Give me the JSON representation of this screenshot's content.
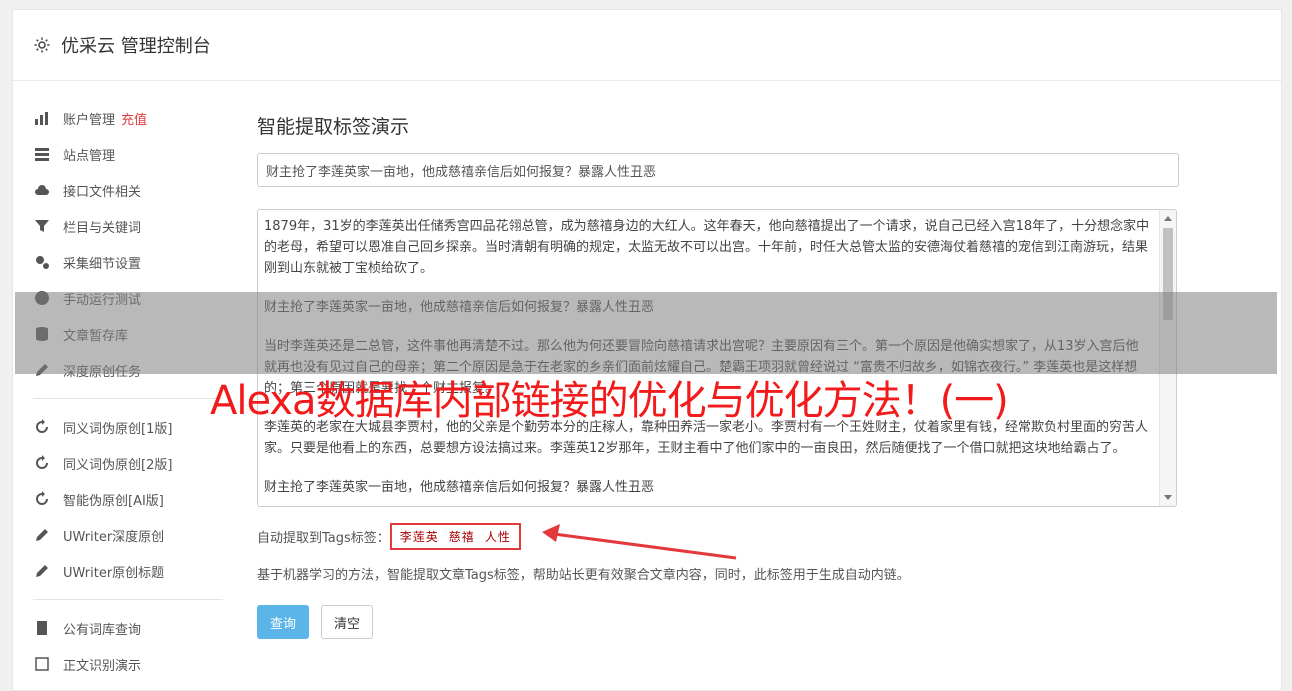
{
  "header": {
    "title": "优采云 管理控制台",
    "icon": "gear-icon"
  },
  "sidebar": {
    "groups": [
      [
        {
          "label": "账户管理",
          "extra": "充值",
          "icon": "bar-chart-icon"
        },
        {
          "label": "站点管理",
          "icon": "server-icon"
        },
        {
          "label": "接口文件相关",
          "icon": "cloud-upload-icon"
        },
        {
          "label": "栏目与关键词",
          "icon": "filter-icon"
        },
        {
          "label": "采集细节设置",
          "icon": "cogs-icon"
        },
        {
          "label": "手动运行测试",
          "icon": "play-icon"
        },
        {
          "label": "文章暂存库",
          "icon": "database-icon"
        },
        {
          "label": "深度原创任务",
          "icon": "edit-icon"
        }
      ],
      [
        {
          "label": "同义词伪原创[1版]",
          "icon": "refresh-icon"
        },
        {
          "label": "同义词伪原创[2版]",
          "icon": "refresh-icon"
        },
        {
          "label": "智能伪原创[AI版]",
          "icon": "refresh-icon"
        },
        {
          "label": "UWriter深度原创",
          "icon": "edit-icon"
        },
        {
          "label": "UWriter原创标题",
          "icon": "edit-icon"
        }
      ],
      [
        {
          "label": "公有词库查询",
          "icon": "book-icon"
        },
        {
          "label": "正文识别演示",
          "icon": "square-icon"
        }
      ]
    ]
  },
  "main": {
    "heading": "智能提取标签演示",
    "title_value": "财主抢了李莲英家一亩地，他成慈禧亲信后如何报复？暴露人性丑恶",
    "content_paragraphs": [
      "1879年，31岁的李莲英出任储秀宫四品花翎总管，成为慈禧身边的大红人。这年春天，他向慈禧提出了一个请求，说自己已经入宫18年了，十分想念家中的老母，希望可以恩准自己回乡探亲。当时清朝有明确的规定，太监无故不可以出宫。十年前，时任大总管太监的安德海仗着慈禧的宠信到江南游玩，结果刚到山东就被丁宝桢给砍了。",
      "财主抢了李莲英家一亩地，他成慈禧亲信后如何报复？暴露人性丑恶",
      "当时李莲英还是二总管，这件事他再清楚不过。那么他为何还要冒险向慈禧请求出宫呢？主要原因有三个。第一个原因是他确实想家了，从13岁入宫后他就再也没有见过自己的母亲；第二个原因是急于在老家的乡亲们面前炫耀自己。楚霸王项羽就曾经说过 “富贵不归故乡，如锦衣夜行。” 李莲英也是这样想的；第三个原因就是要找一个财主报复。",
      "李莲英的老家在大城县李贾村，他的父亲是个勤劳本分的庄稼人，靠种田养活一家老小。李贾村有一个王姓财主，仗着家里有钱，经常欺负村里面的穷苦人家。只要是他看上的东西，总要想方设法搞过来。李莲英12岁那年，王财主看中了他们家中的一亩良田，然后随便找了一个借口就把这块地给霸占了。",
      "财主抢了李莲英家一亩地，他成慈禧亲信后如何报复？暴露人性丑恶"
    ],
    "tags_label": "自动提取到Tags标签：",
    "tags": [
      "李莲英",
      "慈禧",
      "人性"
    ],
    "description": "基于机器学习的方法，智能提取文章Tags标签，帮助站长更有效聚合文章内容，同时，此标签用于生成自动内链。",
    "query_button": "查询",
    "clear_button": "清空"
  },
  "banner": {
    "text": "Alexa数据库内部链接的优化与优化方法！(一)",
    "color": "#f21a1a"
  }
}
